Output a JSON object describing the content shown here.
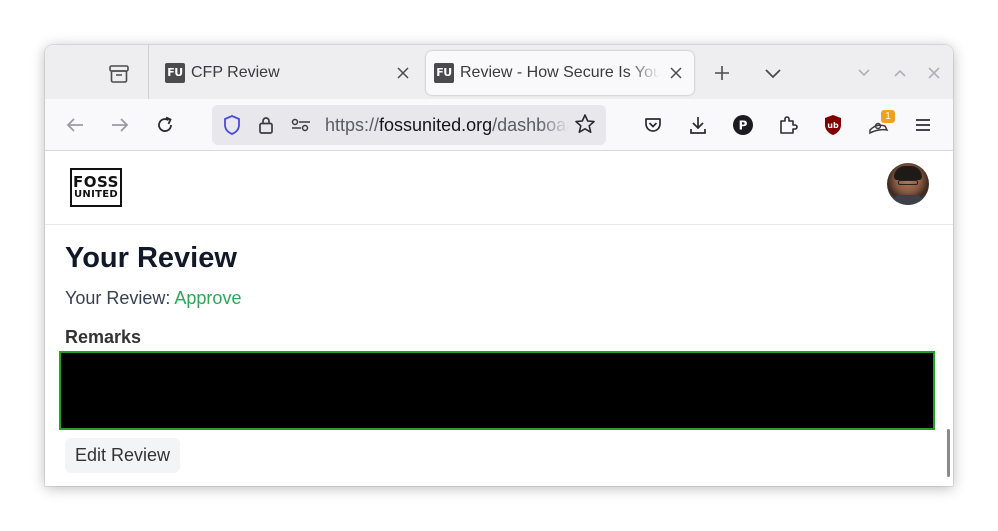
{
  "browser": {
    "tabs": [
      {
        "title": "CFP Review",
        "favicon": "FU",
        "active": false
      },
      {
        "title": "Review - How Secure Is Your",
        "favicon": "FU",
        "active": true
      }
    ],
    "url": {
      "scheme": "https://",
      "host": "fossunited.org",
      "path": "/dashboard"
    },
    "extensions": {
      "ublock_badge": "1"
    },
    "icons": [
      "tabs-list-icon",
      "close-icon",
      "plus-icon",
      "chevron-down-icon",
      "minimize-icon",
      "maximize-icon",
      "window-close-icon",
      "back-arrow-icon",
      "forward-arrow-icon",
      "reload-icon",
      "shield-icon",
      "lock-icon",
      "permissions-icon",
      "star-icon",
      "pocket-icon",
      "download-icon",
      "p-extension-icon",
      "extensions-icon",
      "ublock-icon",
      "hamburger-menu-icon"
    ]
  },
  "site": {
    "logo": {
      "line1": "FOSS",
      "line2": "UNITED"
    }
  },
  "page": {
    "title": "Your Review",
    "review_label": "Your Review: ",
    "review_value": "Approve",
    "remarks_label": "Remarks",
    "edit_button": "Edit Review"
  },
  "colors": {
    "approve_green": "#2fa55a",
    "remarks_border": "#25a025",
    "remarks_fill": "#000000"
  }
}
